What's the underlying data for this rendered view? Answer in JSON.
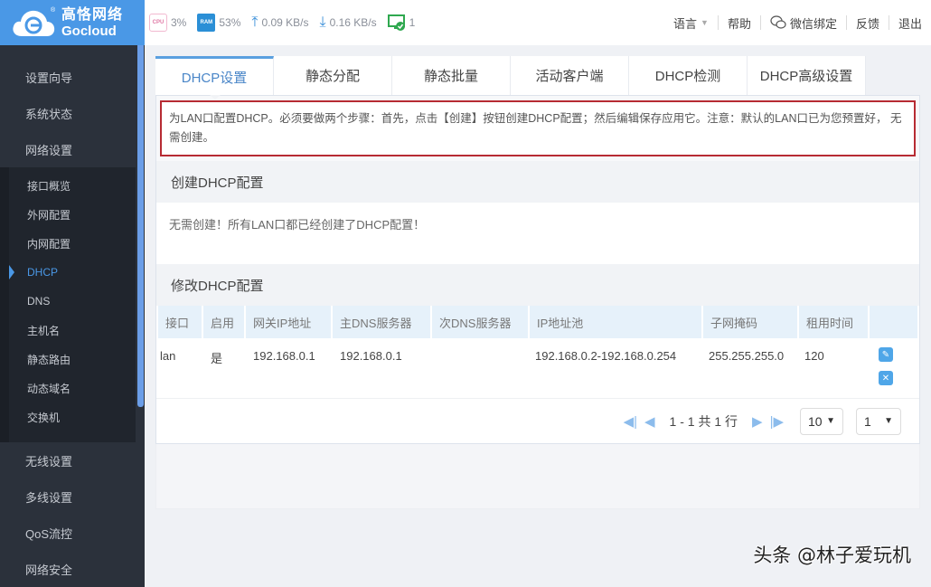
{
  "brand": {
    "name_cn": "高恪网络",
    "name_en": "Gocloud",
    "color": "#4a98e6"
  },
  "stats": {
    "cpu_label": "CPU",
    "cpu": "3%",
    "ram_label": "RAM",
    "ram": "53%",
    "upload": "0.09 KB/s",
    "download": "0.16 KB/s",
    "devices": "1"
  },
  "topnav": {
    "language": "语言",
    "help": "帮助",
    "wechat": "微信绑定",
    "feedback": "反馈",
    "logout": "退出"
  },
  "sidebar": {
    "items_top": [
      "设置向导",
      "系统状态",
      "网络设置"
    ],
    "sub_items": [
      "接口概览",
      "外网配置",
      "内网配置",
      "DHCP",
      "DNS",
      "主机名",
      "静态路由",
      "动态域名",
      "交换机"
    ],
    "active_sub": "DHCP",
    "items_bottom": [
      "无线设置",
      "多线设置",
      "QoS流控",
      "网络安全"
    ]
  },
  "tabs": [
    "DHCP设置",
    "静态分配",
    "静态批量",
    "活动客户端",
    "DHCP检测",
    "DHCP高级设置"
  ],
  "active_tab": "DHCP设置",
  "notice": "为LAN口配置DHCP。必须要做两个步骤：首先，点击【创建】按钮创建DHCP配置；然后编辑保存应用它。注意：默认的LAN口已为您预置好， 无需创建。",
  "create_section": {
    "title": "创建DHCP配置",
    "message": "无需创建！所有LAN口都已经创建了DHCP配置！"
  },
  "modify_section": {
    "title": "修改DHCP配置",
    "columns": [
      "接口",
      "启用",
      "网关IP地址",
      "主DNS服务器",
      "次DNS服务器",
      "IP地址池",
      "子网掩码",
      "租用时间",
      ""
    ],
    "rows": [
      [
        "lan",
        "是",
        "192.168.0.1",
        "192.168.0.1",
        "",
        "192.168.0.2-192.168.0.254",
        "255.255.255.0",
        "120"
      ]
    ]
  },
  "pager": {
    "summary": "1 - 1 共 1 行",
    "page_size": "10",
    "page": "1"
  },
  "watermark": "头条 @林子爱玩机"
}
